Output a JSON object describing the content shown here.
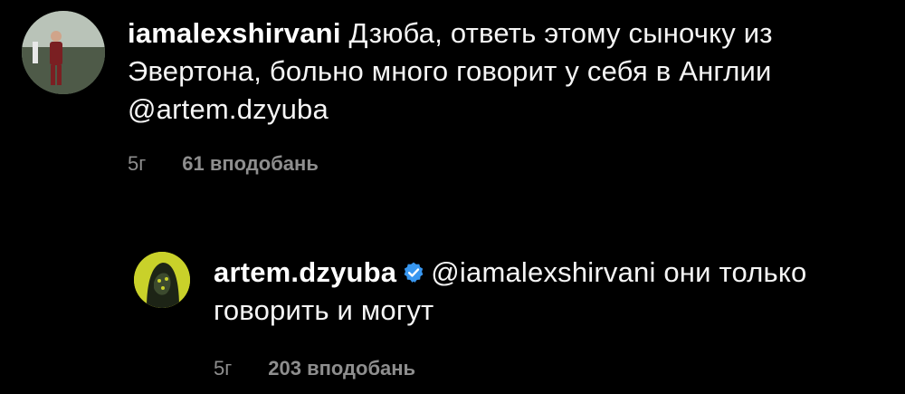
{
  "comments": [
    {
      "username": "iamalexshirvani",
      "text": "Дзюба, ответь этому сыночку из Эвертона, больно много говорит у себя в Англии @artem.dzyuba",
      "time": "5г",
      "likes": "61 вподобань",
      "avatar_icon": "user-photo-icon"
    },
    {
      "username": "artem.dzyuba",
      "verified": true,
      "text": "@iamalexshirvani они только говорить и могут",
      "time": "5г",
      "likes": "203 вподобань",
      "avatar_icon": "user-photo-icon"
    }
  ],
  "colors": {
    "background": "#000000",
    "text": "#f5f5f5",
    "meta": "#8e8e8e",
    "verified": "#3897f0"
  }
}
